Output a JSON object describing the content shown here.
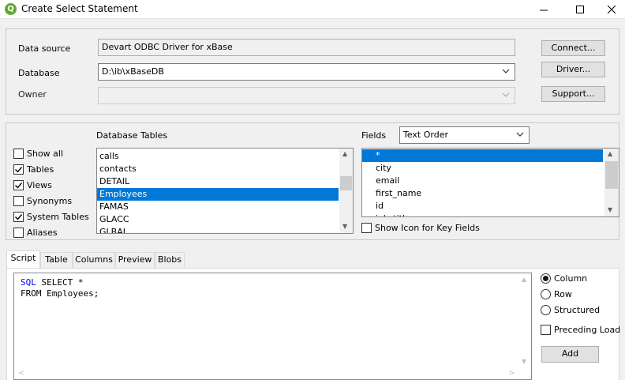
{
  "window": {
    "title": "Create Select Statement",
    "app_icon_letter": "Q"
  },
  "connection": {
    "data_source_label": "Data source",
    "data_source_value": "Devart ODBC Driver for xBase",
    "database_label": "Database",
    "database_value": "D:\\ib\\xBaseDB",
    "owner_label": "Owner",
    "owner_value": "",
    "connect_button": "Connect...",
    "driver_button": "Driver...",
    "support_button": "Support..."
  },
  "options": {
    "show_all": {
      "label": "Show all",
      "checked": false
    },
    "tables": {
      "label": "Tables",
      "checked": true
    },
    "views": {
      "label": "Views",
      "checked": true
    },
    "synonyms": {
      "label": "Synonyms",
      "checked": false
    },
    "system_tables": {
      "label": "System Tables",
      "checked": true
    },
    "aliases": {
      "label": "Aliases",
      "checked": false
    }
  },
  "database_tables": {
    "label": "Database Tables",
    "items": [
      "calls",
      "contacts",
      "DETAIL",
      "Employees",
      "FAMAS",
      "GLACC",
      "GLBAL"
    ],
    "selected": "Employees"
  },
  "fields": {
    "label": "Fields",
    "order_value": "Text Order",
    "items": [
      "*",
      "city",
      "email",
      "first_name",
      "id",
      "job_title"
    ],
    "selected": "*",
    "show_icon_label": "Show Icon for Key Fields",
    "show_icon_checked": false
  },
  "tabs": [
    "Script",
    "Table",
    "Columns",
    "Preview",
    "Blobs"
  ],
  "active_tab": "Script",
  "script": {
    "line1_keyword": "SQL",
    "line1_rest": " SELECT *",
    "line2": "FROM Employees;"
  },
  "layout_options": {
    "column_label": "Column",
    "row_label": "Row",
    "structured_label": "Structured",
    "selected": "Column",
    "preceding_load_label": "Preceding Load",
    "preceding_load_checked": false,
    "add_button": "Add"
  }
}
